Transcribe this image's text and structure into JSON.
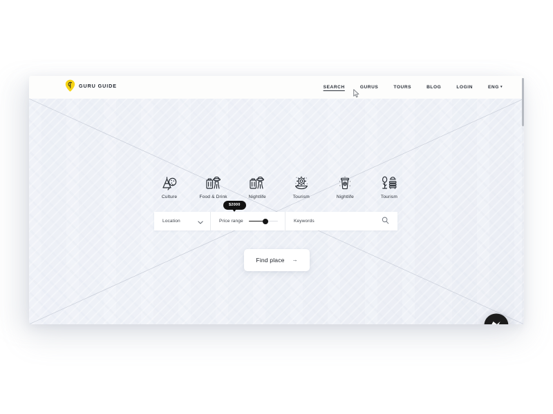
{
  "header": {
    "brand": {
      "name": "GURU GUIDE",
      "logo_icon": "map-pin-icon",
      "logo_color": "#F6D414",
      "logo_mark_color": "#1C1C1C"
    },
    "nav": [
      {
        "label": "SEARCH",
        "active": true
      },
      {
        "label": "GURUS",
        "active": false
      },
      {
        "label": "TOURS",
        "active": false
      },
      {
        "label": "BLOG",
        "active": false
      },
      {
        "label": "LOGIN",
        "active": false
      },
      {
        "label": "ENG",
        "active": false,
        "caret": "▾"
      }
    ]
  },
  "hero": {
    "categories": [
      {
        "label": "Culture",
        "icon": "easel-palette-icon"
      },
      {
        "label": "Food & Drink",
        "icon": "suitcase-hat-icon"
      },
      {
        "label": "Nightlife",
        "icon": "suitcase-hat-icon"
      },
      {
        "label": "Tourism",
        "icon": "sun-boat-icon"
      },
      {
        "label": "Nightlife",
        "icon": "coffee-cup-icon"
      },
      {
        "label": "Tourism",
        "icon": "tree-bench-icon"
      }
    ],
    "search": {
      "location": {
        "label": "Location",
        "icon": "chevron-down-icon"
      },
      "price": {
        "label": "Price range",
        "value": "$2000",
        "slider_percent": 52
      },
      "keywords": {
        "placeholder": "Keywords",
        "value": "",
        "icon": "search-icon"
      }
    },
    "cta": {
      "label": "Find place",
      "arrow": "→"
    }
  },
  "widgets": {
    "messenger": {
      "name": "messenger-bubble",
      "bg_color": "#1C1C1C",
      "mark_color": "#FFFFFF"
    }
  },
  "colors": {
    "accent_yellow": "#F6D414",
    "ink": "#1D2128",
    "hero_bg": "#EEF1F7",
    "header_bg": "#FDFDFC"
  }
}
